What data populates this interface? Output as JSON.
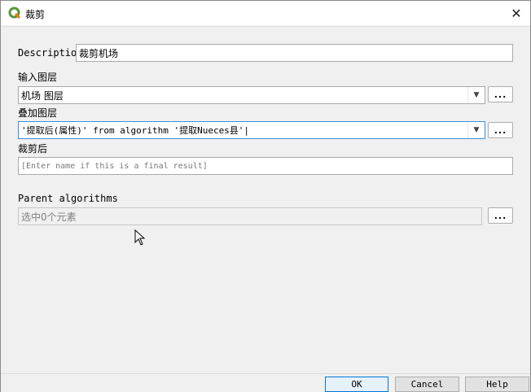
{
  "window": {
    "title": "裁剪"
  },
  "form": {
    "description_label": "Description",
    "description_value": "裁剪机场",
    "input_layer_label": "输入图层",
    "input_layer_value": "机场 图层",
    "overlay_layer_label": "叠加图层",
    "overlay_layer_value": "'提取后(属性)' from algorithm '提取Nueces县'|",
    "clip_output_label": "裁剪后",
    "clip_output_placeholder": "[Enter name if this is a final result]",
    "parent_algorithms_label": "Parent algorithms",
    "parent_algorithms_value": "选中0个元素",
    "dots": "..."
  },
  "buttons": {
    "ok": "OK",
    "cancel": "Cancel",
    "help": "Help"
  },
  "colors": {
    "focus_border": "#3c8ede",
    "default_button_border": "#0078d7",
    "qgis_green": "#589632"
  }
}
